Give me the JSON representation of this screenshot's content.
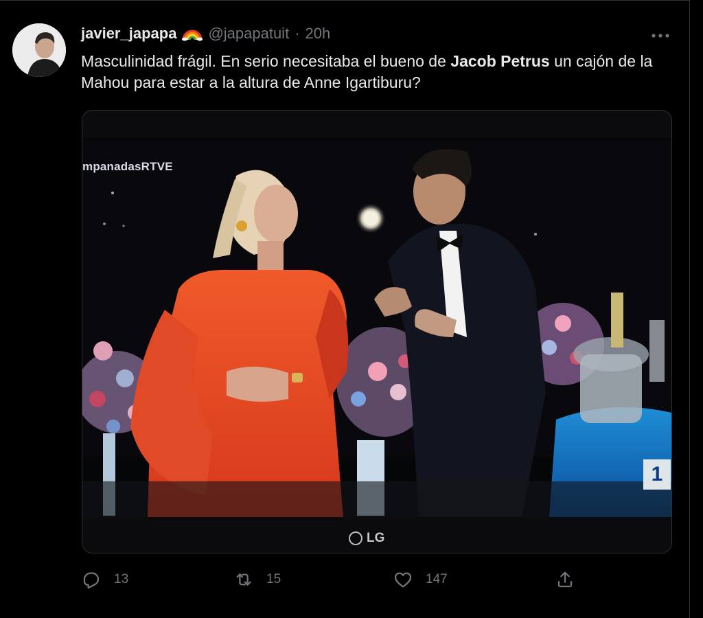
{
  "tweet": {
    "display_name": "javier_japapa",
    "handle": "@japapatuit",
    "separator": "·",
    "time": "20h",
    "text_before": "Masculinidad frágil. En serio necesitaba el bueno de ",
    "text_bold": "Jacob Petrus",
    "text_after": " un cajón de la Mahou para estar a la altura de Anne Igartiburu?"
  },
  "media": {
    "overlay_tag": "mpanadasRTVE",
    "tv_brand": "LG",
    "channel_number": "1"
  },
  "actions": {
    "reply_count": "13",
    "retweet_count": "15",
    "like_count": "147"
  },
  "icons": {
    "more": "more-horizontal-icon",
    "reply": "reply-icon",
    "retweet": "retweet-icon",
    "like": "heart-icon",
    "share": "share-icon"
  }
}
